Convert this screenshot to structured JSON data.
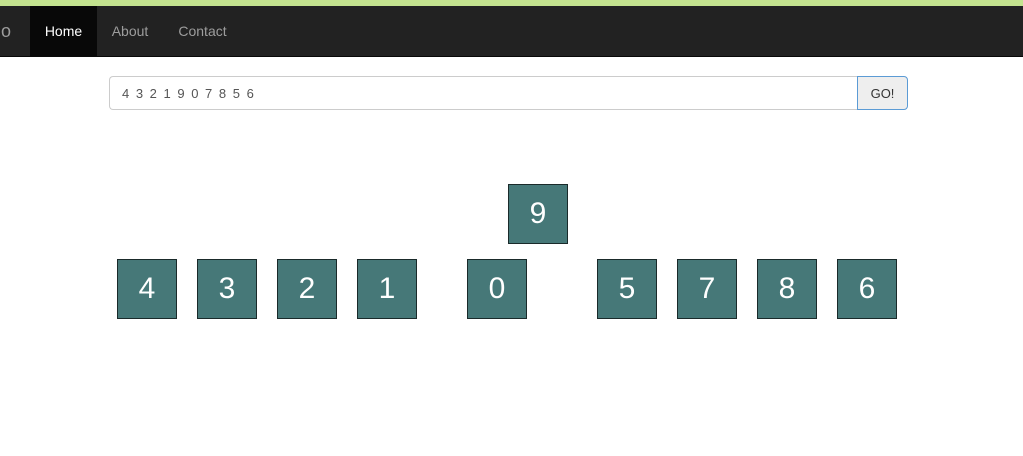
{
  "navbar": {
    "brand_partial": "no",
    "items": [
      {
        "label": "Home"
      },
      {
        "label": "About"
      },
      {
        "label": "Contact"
      }
    ]
  },
  "search": {
    "value": "4 3 2 1 9 0 7 8 5 6",
    "button_label": "GO!"
  },
  "tiles": {
    "top": "9",
    "row": [
      "4",
      "3",
      "2",
      "1",
      "0",
      "5",
      "7",
      "8",
      "6"
    ]
  },
  "colors": {
    "accent_bar": "#c3e38f",
    "navbar": "#222222",
    "tile": "#467878"
  }
}
